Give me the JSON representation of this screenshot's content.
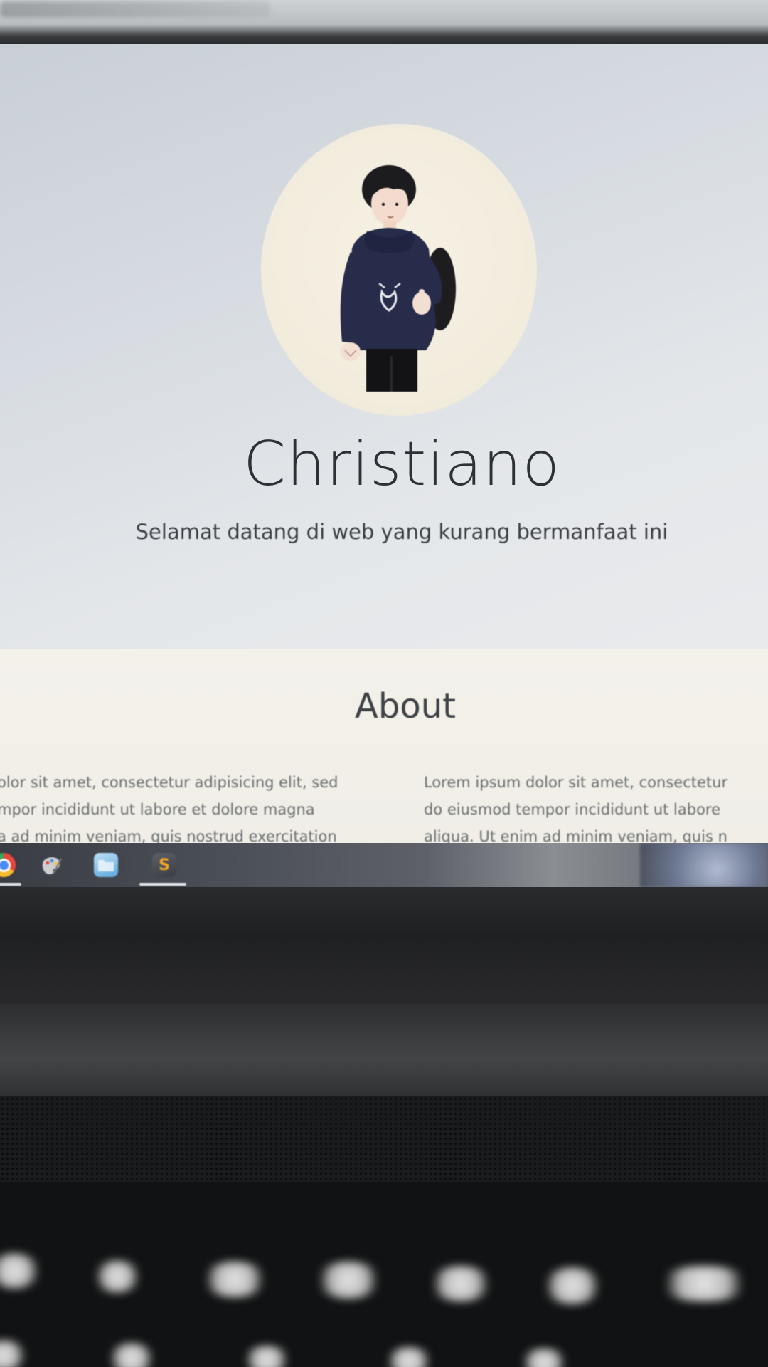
{
  "hero": {
    "name": "Christiano",
    "tagline": "Selamat datang di web yang kurang bermanfaat ini"
  },
  "about": {
    "title": "About",
    "left_column": [
      "olor sit amet, consectetur adipisicing elit, sed",
      "mpor incididunt ut labore et dolore magna",
      "a ad minim veniam, quis nostrud exercitation"
    ],
    "right_column": [
      "Lorem ipsum dolor sit amet, consectetur",
      "do eiusmod tempor incididunt ut labore",
      "aliqua. Ut enim ad minim veniam, quis n"
    ]
  },
  "taskbar": {
    "apps": [
      "chrome-icon",
      "paint-icon",
      "file-explorer-icon",
      "sublime-text-icon"
    ],
    "sublime_glyph": "S"
  },
  "colors": {
    "hero_bg": "#d6dbe1",
    "about_bg": "#f1efe8",
    "name_text": "#2d3034",
    "avatar_bg": "#f3eedf",
    "hoodie": "#262c4a"
  }
}
